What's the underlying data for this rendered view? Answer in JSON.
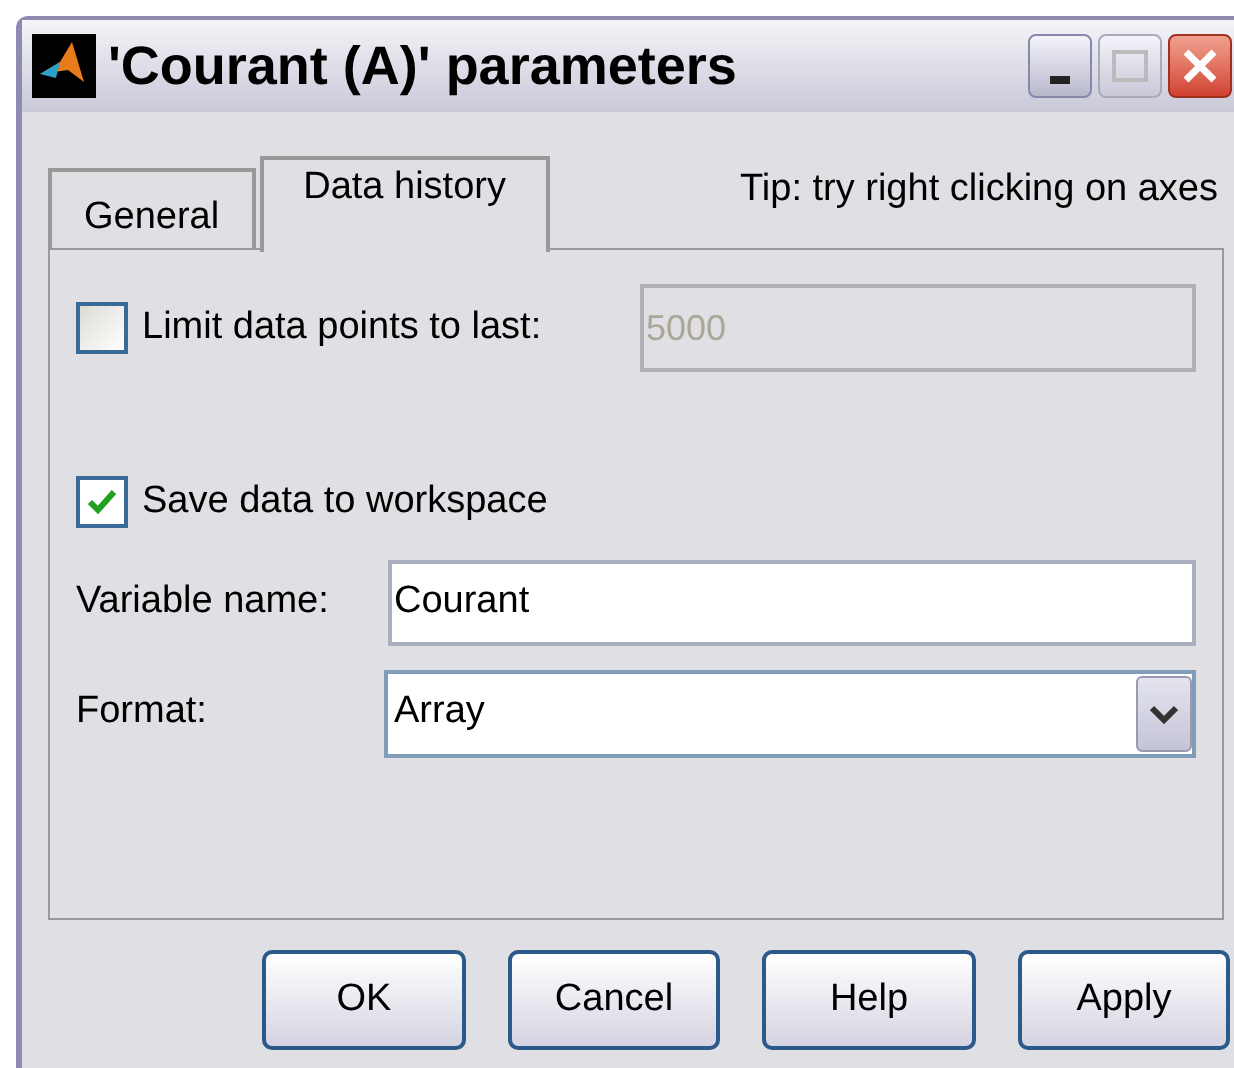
{
  "window": {
    "title": "'Courant (A)' parameters"
  },
  "tabs": [
    {
      "label": "General",
      "selected": false
    },
    {
      "label": "Data history",
      "selected": true
    }
  ],
  "tip": "Tip: try right clicking on axes",
  "limit": {
    "label": "Limit data points to last:",
    "checked": false,
    "value": "5000",
    "disabled": true
  },
  "save": {
    "label": "Save data to workspace",
    "checked": true
  },
  "variable_name": {
    "label": "Variable name:",
    "value": "Courant"
  },
  "format": {
    "label": "Format:",
    "value": "Array"
  },
  "buttons": [
    "OK",
    "Cancel",
    "Help",
    "Apply"
  ]
}
